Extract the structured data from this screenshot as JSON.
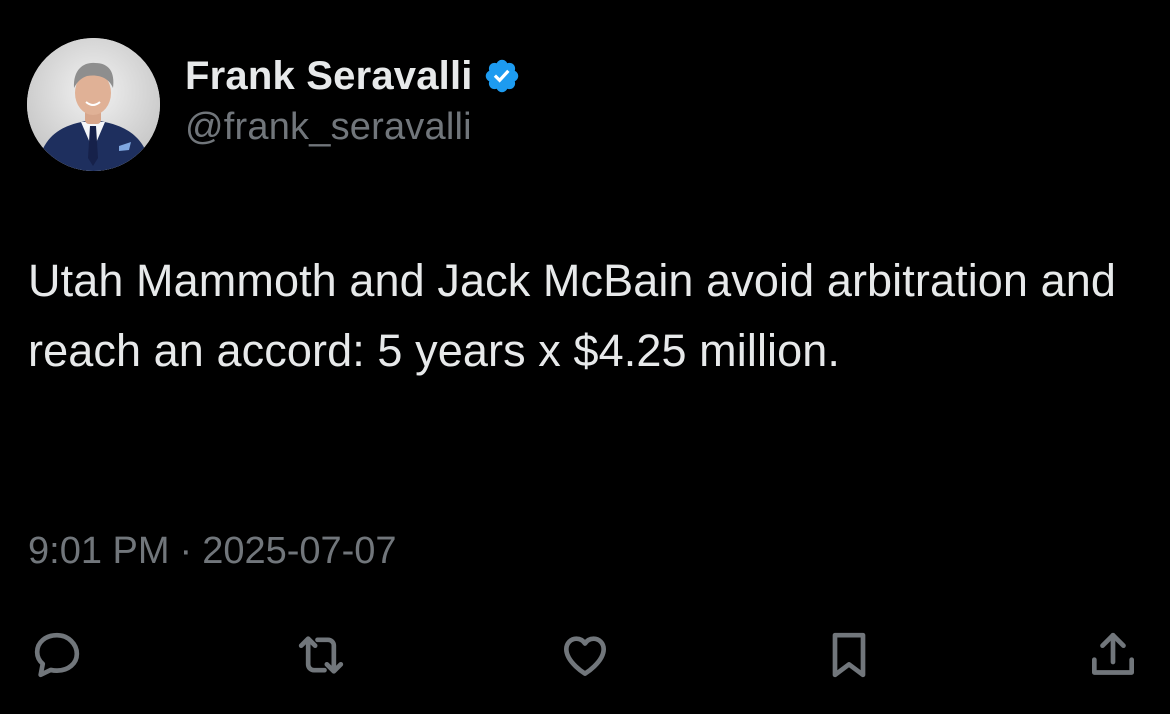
{
  "author": {
    "display_name": "Frank Seravalli",
    "handle": "@frank_seravalli",
    "verified_icon": "verified-badge-icon"
  },
  "tweet": {
    "text": "Utah Mammoth and Jack McBain avoid arbitration and reach an accord: 5 years x $4.25 million.",
    "time": "9:01 PM",
    "separator": "·",
    "date": "2025-07-07"
  },
  "actions": [
    {
      "name": "reply",
      "icon": "speech-bubble-icon"
    },
    {
      "name": "retweet",
      "icon": "retweet-arrows-icon"
    },
    {
      "name": "like",
      "icon": "heart-icon"
    },
    {
      "name": "bookmark",
      "icon": "bookmark-icon"
    },
    {
      "name": "share",
      "icon": "share-upload-icon"
    }
  ],
  "colors": {
    "background": "#000000",
    "text": "#e7e9ea",
    "secondary": "#71767b",
    "verified": "#1d9bf0"
  }
}
